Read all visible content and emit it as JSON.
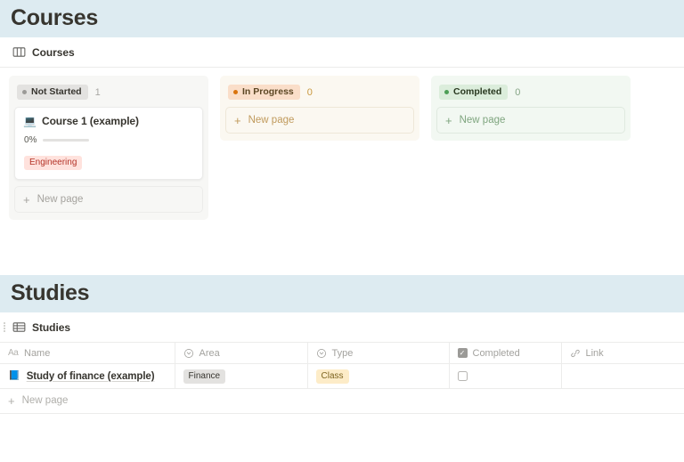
{
  "theme": {
    "heading_highlight": "#ddebf1",
    "page_bg": "#ffffff",
    "text": "#37352f",
    "muted": "#a3a29e",
    "border": "#ececeb",
    "accent_blue": "#2383e2"
  },
  "courses_section": {
    "heading": "Courses",
    "view": {
      "icon": "board-view-icon",
      "title": "Courses"
    },
    "columns": [
      {
        "id": "not-started",
        "status_label": "Not Started",
        "count": "1",
        "pill_style": "gray",
        "column_bg": "#f7f7f5",
        "new_page_label": "New page",
        "cards": [
          {
            "emoji": "💻",
            "emoji_name": "laptop-icon",
            "title": "Course 1 (example)",
            "progress_label": "0%",
            "progress_value": 0,
            "tags": [
              {
                "label": "Engineering",
                "style": "red"
              }
            ]
          }
        ]
      },
      {
        "id": "in-progress",
        "status_label": "In Progress",
        "count": "0",
        "pill_style": "yellow",
        "column_bg": "#fbf8f1",
        "new_page_label": "New page",
        "cards": []
      },
      {
        "id": "completed",
        "status_label": "Completed",
        "count": "0",
        "pill_style": "green",
        "column_bg": "#f2f8f2",
        "new_page_label": "New page",
        "cards": []
      }
    ]
  },
  "studies_section": {
    "heading": "Studies",
    "view": {
      "icon": "table-view-icon",
      "title": "Studies"
    },
    "table": {
      "columns": [
        {
          "label": "Name",
          "icon": "text-property-icon"
        },
        {
          "label": "Area",
          "icon": "select-property-icon"
        },
        {
          "label": "Type",
          "icon": "select-property-icon"
        },
        {
          "label": "Completed",
          "icon": "checkbox-property-icon"
        },
        {
          "label": "Link",
          "icon": "url-property-icon"
        }
      ],
      "rows": [
        {
          "emoji": "📘",
          "emoji_name": "blue-book-icon",
          "name": "Study of finance (example)",
          "area": {
            "label": "Finance",
            "style": "gray"
          },
          "type": {
            "label": "Class",
            "style": "yellow"
          },
          "completed": false,
          "link": ""
        }
      ],
      "new_row_label": "New page"
    }
  }
}
